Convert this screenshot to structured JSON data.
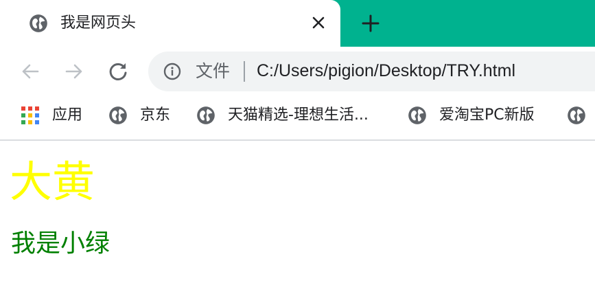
{
  "tab": {
    "title": "我是网页头",
    "close_icon": "close-icon",
    "favicon": "globe-icon"
  },
  "new_tab": {
    "icon": "plus-icon"
  },
  "toolbar": {
    "back_icon": "arrow-left-icon",
    "forward_icon": "arrow-right-icon",
    "reload_icon": "reload-icon",
    "omnibox": {
      "info_icon": "info-icon",
      "scheme_label": "文件",
      "url": "C:/Users/pigion/Desktop/TRY.html"
    }
  },
  "bookmarks": [
    {
      "label": "应用",
      "icon": "apps-grid-icon"
    },
    {
      "label": "京东",
      "icon": "globe-icon"
    },
    {
      "label": "天猫精选-理想生活...",
      "icon": "globe-icon"
    },
    {
      "label": "爱淘宝PC新版",
      "icon": "globe-icon"
    },
    {
      "label": "",
      "icon": "globe-icon"
    }
  ],
  "page": {
    "heading": "大黄",
    "paragraph": "我是小绿"
  },
  "colors": {
    "tabstrip": "#00b28f",
    "heading": "#ffff00",
    "paragraph": "#008000"
  }
}
